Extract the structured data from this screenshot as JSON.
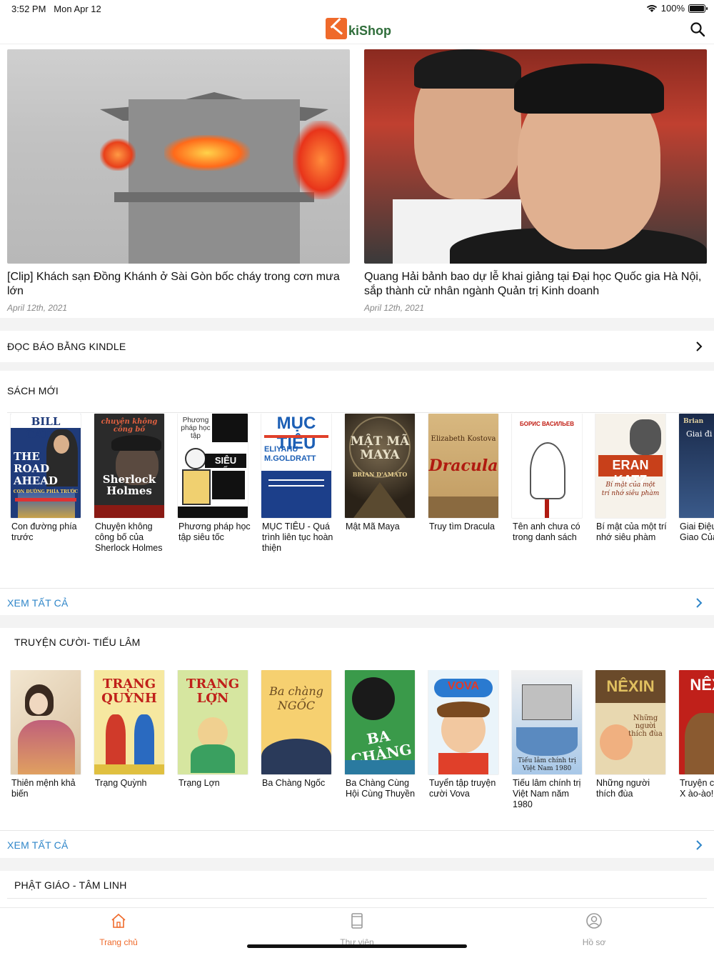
{
  "status": {
    "time": "3:52 PM",
    "date": "Mon Apr 12",
    "battery": "100%",
    "battery_level": 1.0
  },
  "header": {
    "logo_text": "kiShop"
  },
  "colors": {
    "accent": "#ef6a2b",
    "link": "#2f86c9",
    "logo_green": "#2f6d3a"
  },
  "hero": [
    {
      "title": "[Clip] Khách sạn Đồng Khánh ở Sài Gòn bốc cháy trong cơn mưa lớn",
      "date": "April 12th, 2021"
    },
    {
      "title": "Quang Hải bảnh bao dự lễ khai giảng tại Đại học Quốc gia Hà Nội, sắp thành cử nhân ngành Quản trị Kinh doanh",
      "date": "April 12th, 2021"
    }
  ],
  "kindle": {
    "label": "ĐỌC BÁO BẰNG KINDLE"
  },
  "sections": [
    {
      "title": "SÁCH MỚI",
      "see_all": "XEM TẤT CẢ",
      "books": [
        {
          "name": "Con đường phía trước"
        },
        {
          "name": "Chuyện không công bố của Sherlock Holmes"
        },
        {
          "name": "Phương pháp học tập siêu tốc"
        },
        {
          "name": "MỤC TIÊU - Quá trình liên tục hoàn thiện"
        },
        {
          "name": "Mật Mã Maya"
        },
        {
          "name": "Truy tìm Dracula"
        },
        {
          "name": "Tên anh chưa có trong danh sách"
        },
        {
          "name": "Bí mật của một trí nhớ siêu phàm"
        },
        {
          "name": "Giai Điệu Bản Giao Của Vũ T"
        }
      ]
    },
    {
      "title": "TRUYỆN CƯỜI- TIẾU LÂM",
      "see_all": "XEM TẤT CẢ",
      "books": [
        {
          "name": "Thiên mệnh khả biến"
        },
        {
          "name": "Trạng Quỳnh"
        },
        {
          "name": "Trạng Lợn"
        },
        {
          "name": "Ba Chàng Ngốc"
        },
        {
          "name": "Ba Chàng Cùng Hội Cùng Thuyền"
        },
        {
          "name": "Tuyển tập truyện cười Vova"
        },
        {
          "name": "Tiếu lâm chính trị Việt Nam năm 1980"
        },
        {
          "name": "Những người thích đùa"
        },
        {
          "name": "Truyện c Nêxin - X ào-ào!"
        }
      ]
    },
    {
      "title": "PHẬT GIÁO - TÂM LINH"
    }
  ],
  "covers": {
    "c1": [
      "BILL GATES",
      "THE ROAD AHEAD",
      "CON ĐƯỜNG PHÍA TRƯỚC"
    ],
    "c2": [
      "chuyện không công bố",
      "Sherlock Holmes"
    ],
    "c3": [
      "Phương pháp học tập",
      "SIÊU TỐC"
    ],
    "c4": [
      "MỤC TIÊU",
      "ELIYAHU M.GOLDRATT"
    ],
    "c5": [
      "MẬT MÃ MAYA",
      "BRIAN D'AMATO"
    ],
    "c6": [
      "Elizabeth Kostova",
      "Dracula"
    ],
    "c7": [
      "БОРИС ВАСИЛЬЕВ"
    ],
    "c8": [
      "ERAN KATZ",
      "Bí mật của một trí nhớ siêu phàm"
    ],
    "c9": [
      "Brian",
      "Giai đi"
    ],
    "d2": [
      "TRẠNG QUỲNH"
    ],
    "d3": [
      "TRẠNG LỢN"
    ],
    "d4": [
      "Ba chàng NGỐC"
    ],
    "d5": [
      "BA CHÀNG"
    ],
    "d6": [
      "VOVA"
    ],
    "d7": [
      "Tiếu lâm chính trị Việt Nam 1980"
    ],
    "d8": [
      "NÊXIN",
      "Những người thích đùa"
    ],
    "d9": [
      "NÊXIN"
    ]
  },
  "tabs": [
    {
      "label": "Trang chủ",
      "icon": "home-icon",
      "active": true
    },
    {
      "label": "Thư viện",
      "icon": "library-icon",
      "active": false
    },
    {
      "label": "Hồ sơ",
      "icon": "profile-icon",
      "active": false
    }
  ]
}
